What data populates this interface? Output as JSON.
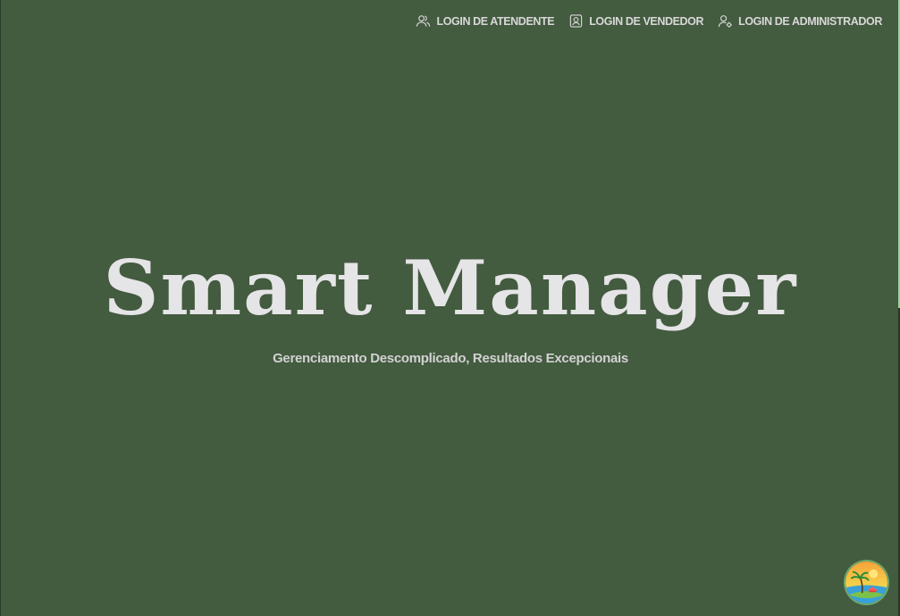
{
  "nav": {
    "items": [
      {
        "label": "LOGIN DE ATENDENTE",
        "icon": "users-icon"
      },
      {
        "label": "LOGIN DE VENDEDOR",
        "icon": "id-badge-icon"
      },
      {
        "label": "LOGIN DE ADMINISTRADOR",
        "icon": "user-gear-icon"
      }
    ]
  },
  "hero": {
    "title": "Smart Manager",
    "subtitle": "Gerenciamento Descomplicado, Resultados Excepcionais"
  },
  "avatar": {
    "icon": "beach-logo-icon"
  },
  "colors": {
    "background": "#435b3f",
    "title": "#e5e4e6",
    "nav_text": "#d8d8d8"
  }
}
